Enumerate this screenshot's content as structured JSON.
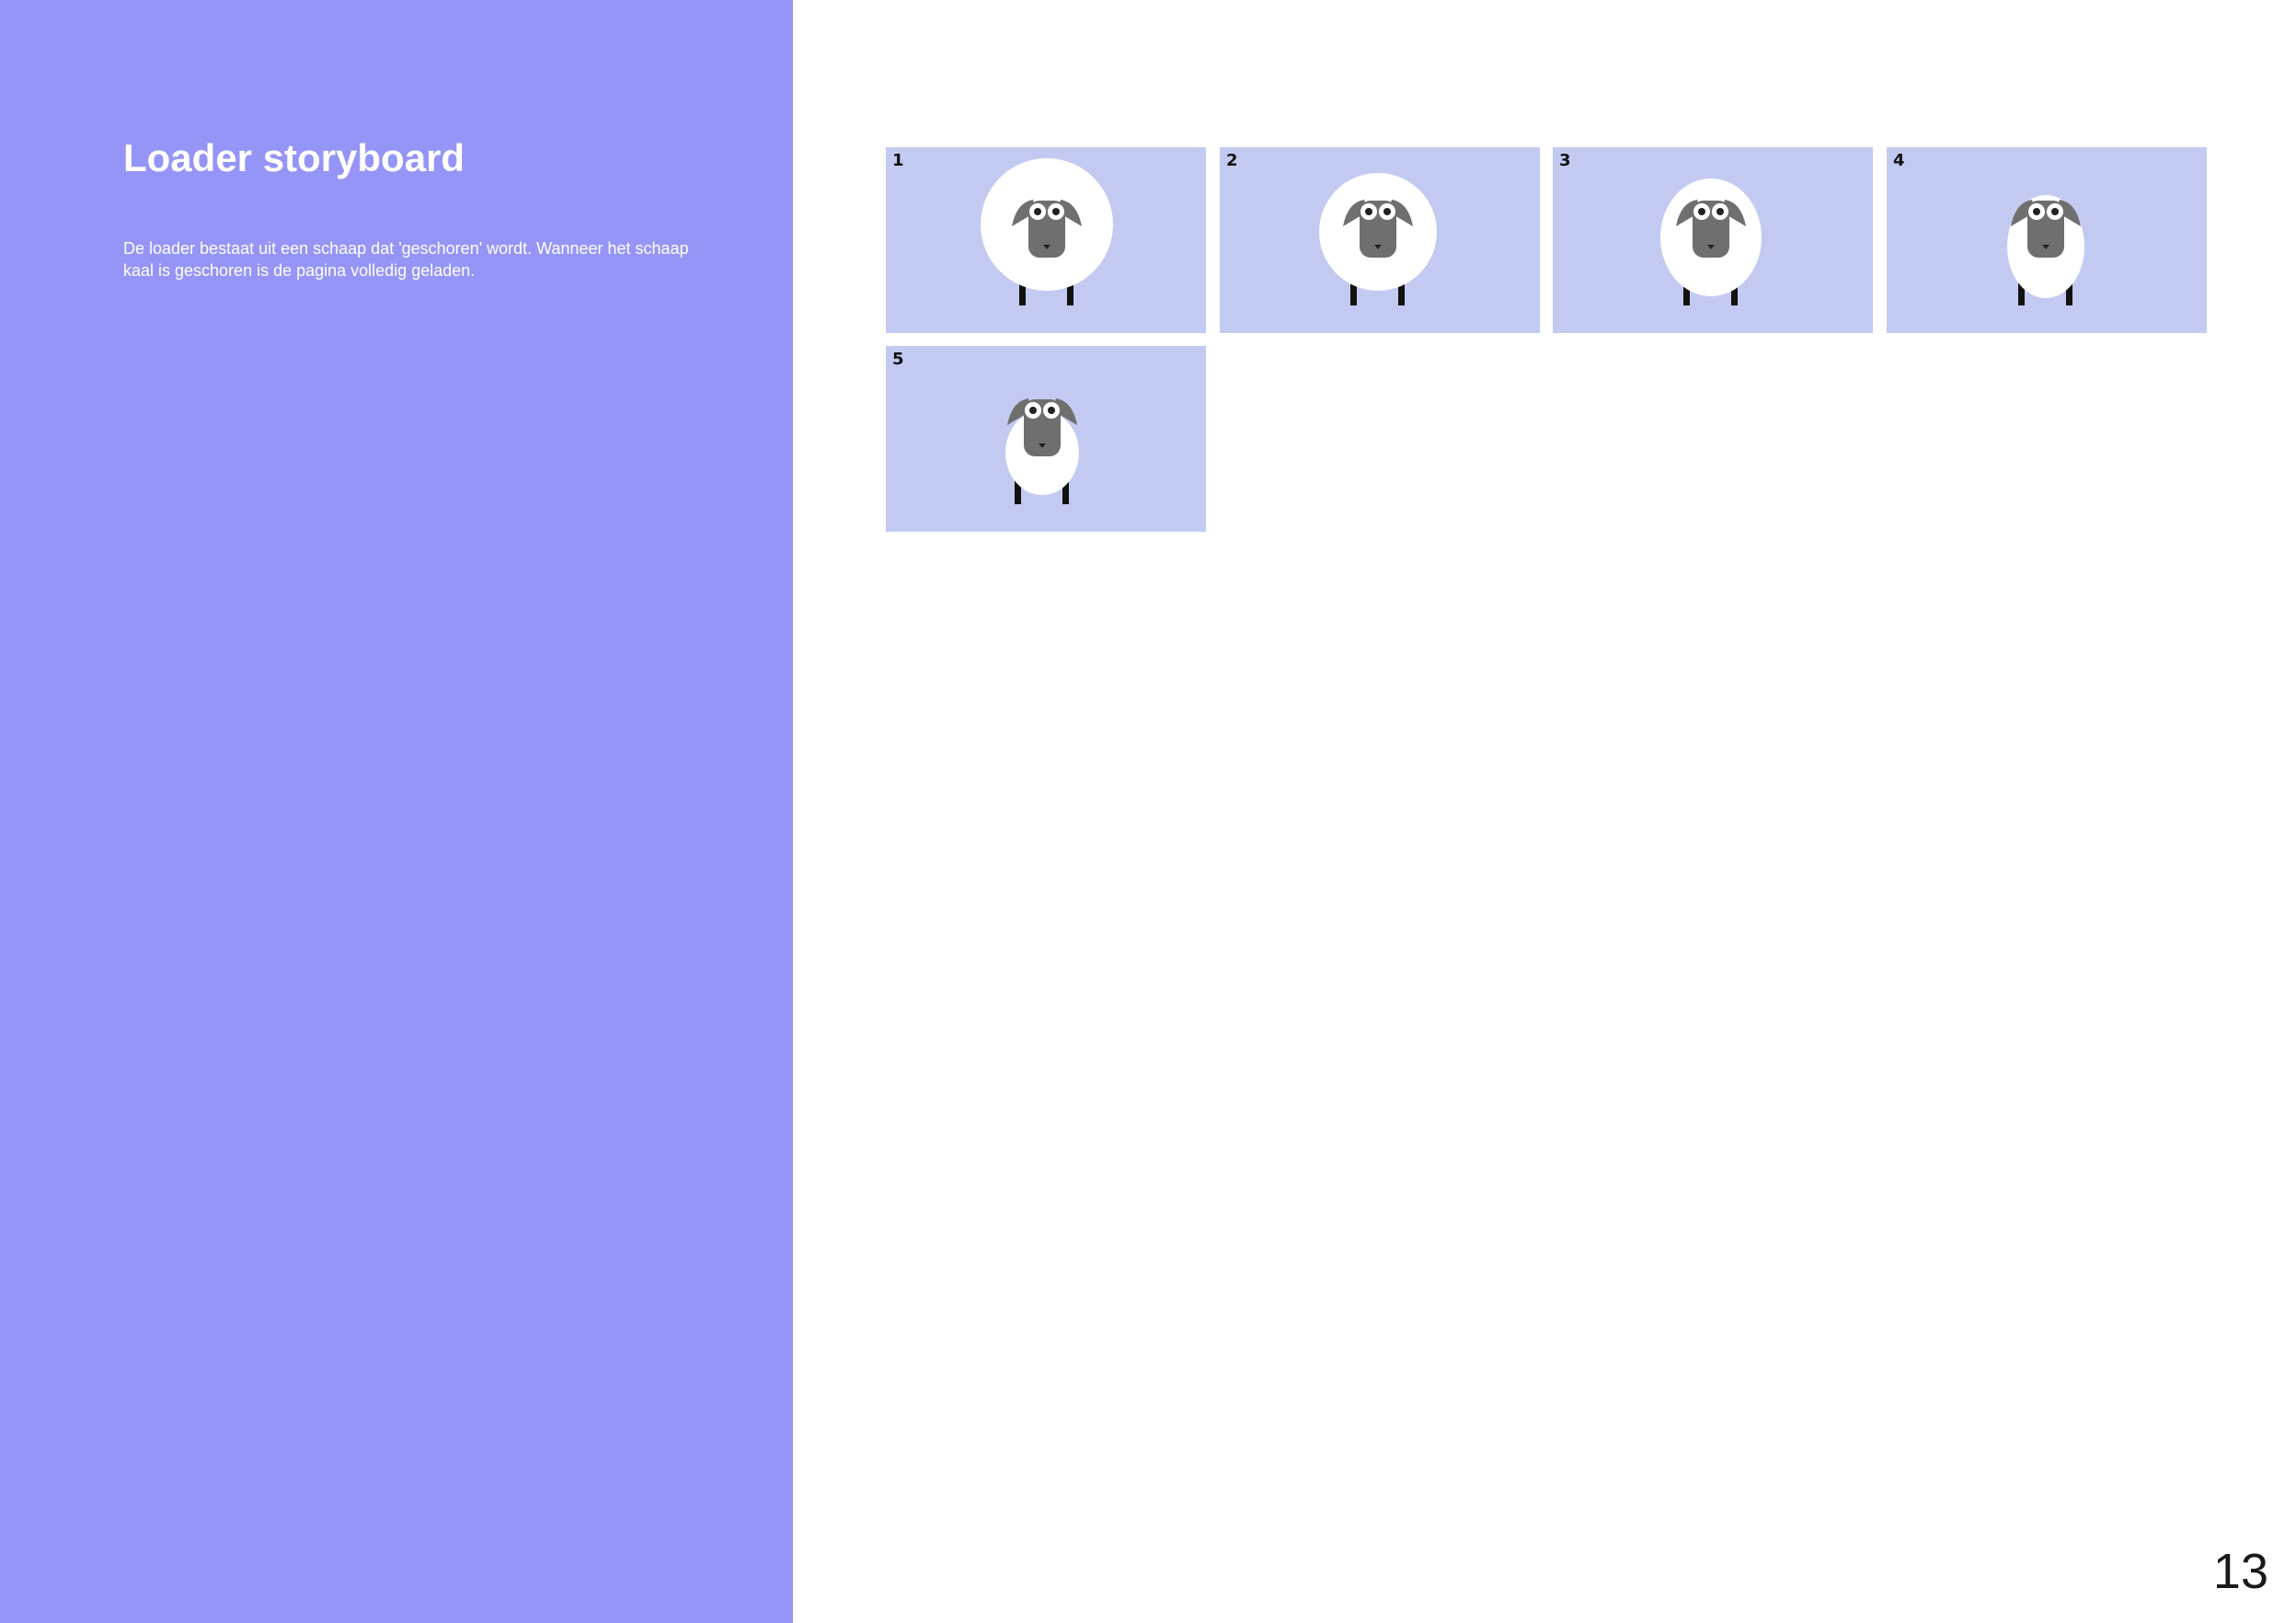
{
  "page": {
    "title": "Loader storyboard",
    "description": "De loader bestaat uit een schaap dat 'geschoren' wordt. Wanneer het schaap kaal is geschoren is de pagina volledig geladen.",
    "number": "13"
  },
  "colors": {
    "sidebar": "#9595f7",
    "frame_background": "#c3caf2",
    "wool": "#ffffff",
    "sheep_face": "#6f6f6f",
    "sheep_legs": "#111111"
  },
  "storyboard": {
    "frames": [
      {
        "number": "1"
      },
      {
        "number": "2"
      },
      {
        "number": "3"
      },
      {
        "number": "4"
      },
      {
        "number": "5"
      }
    ]
  }
}
